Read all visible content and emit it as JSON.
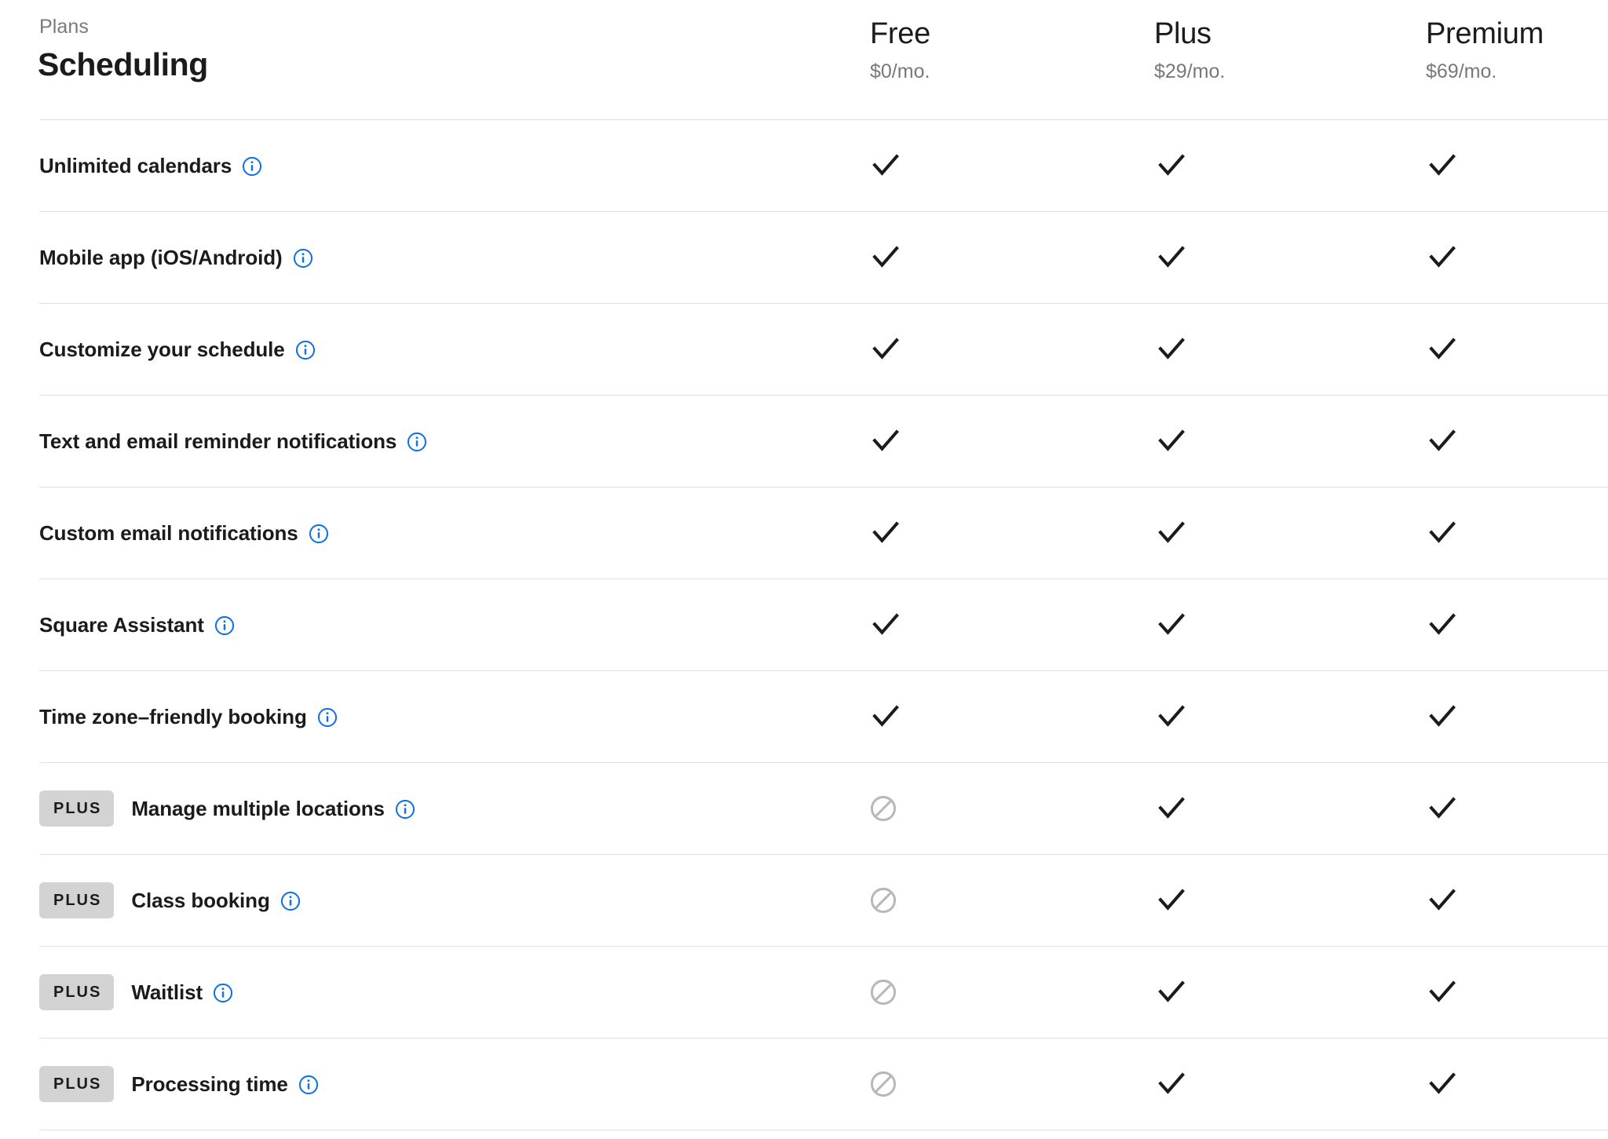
{
  "breadcrumb": "Plans",
  "title": "Scheduling",
  "colors": {
    "info_icon": "#1272e5",
    "check": "#1b1b1b",
    "excluded": "#b8b8b8",
    "badge_bg": "#d3d3d3",
    "divider": "#e0e0e0",
    "muted_text": "#77787a"
  },
  "plans": [
    {
      "name": "Free",
      "price": "$0/mo."
    },
    {
      "name": "Plus",
      "price": "$29/mo."
    },
    {
      "name": "Premium",
      "price": "$69/mo."
    }
  ],
  "icon_names": {
    "info": "info-icon",
    "included": "check-icon",
    "excluded": "not-included-icon"
  },
  "badge_label": "PLUS",
  "features": [
    {
      "badge": null,
      "label": "Unlimited calendars",
      "info": "info-icon",
      "values": [
        "included",
        "included",
        "included"
      ]
    },
    {
      "badge": null,
      "label": "Mobile app (iOS/Android)",
      "info": "info-icon",
      "values": [
        "included",
        "included",
        "included"
      ]
    },
    {
      "badge": null,
      "label": "Customize your schedule",
      "info": "info-icon",
      "values": [
        "included",
        "included",
        "included"
      ]
    },
    {
      "badge": null,
      "label": "Text and email reminder notifications",
      "info": "info-icon",
      "values": [
        "included",
        "included",
        "included"
      ]
    },
    {
      "badge": null,
      "label": "Custom email notifications",
      "info": "info-icon",
      "values": [
        "included",
        "included",
        "included"
      ]
    },
    {
      "badge": null,
      "label": "Square Assistant",
      "info": "info-icon",
      "values": [
        "included",
        "included",
        "included"
      ]
    },
    {
      "badge": null,
      "label": "Time zone–friendly booking",
      "info": "info-icon",
      "values": [
        "included",
        "included",
        "included"
      ]
    },
    {
      "badge": "PLUS",
      "label": "Manage multiple locations",
      "info": "info-icon",
      "values": [
        "excluded",
        "included",
        "included"
      ]
    },
    {
      "badge": "PLUS",
      "label": "Class booking",
      "info": "info-icon",
      "values": [
        "excluded",
        "included",
        "included"
      ]
    },
    {
      "badge": "PLUS",
      "label": "Waitlist",
      "info": "info-icon",
      "values": [
        "excluded",
        "included",
        "included"
      ]
    },
    {
      "badge": "PLUS",
      "label": "Processing time",
      "info": "info-icon",
      "values": [
        "excluded",
        "included",
        "included"
      ]
    }
  ]
}
